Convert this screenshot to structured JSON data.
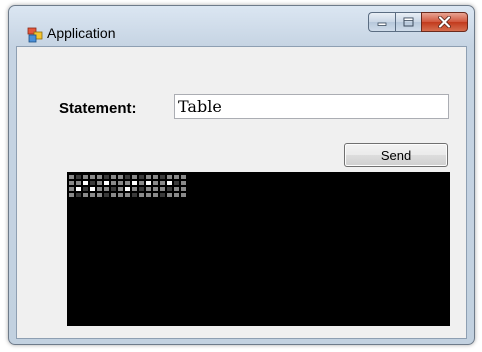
{
  "window": {
    "title": "Application",
    "icon": "application-icon",
    "caption_buttons": [
      {
        "name": "minimize",
        "glyph": "minimize-icon"
      },
      {
        "name": "maximize",
        "glyph": "maximize-icon"
      },
      {
        "name": "close",
        "glyph": "close-icon"
      }
    ]
  },
  "form": {
    "statement_label": "Statement:",
    "statement_value": "Table",
    "send_label": "Send"
  },
  "display": {
    "background": "#000000",
    "led_colors": {
      "off": "#3a3a3a",
      "dim": "#8a8a8a",
      "on": "#ffffff"
    },
    "matrix": [
      "10111011010110111",
      "11101111101011101",
      "11011101110111011",
      "10111011101110111"
    ],
    "bright": [
      "00000000000000000",
      "00100100010100100",
      "01010000100000000",
      "00000000000000000"
    ]
  }
}
